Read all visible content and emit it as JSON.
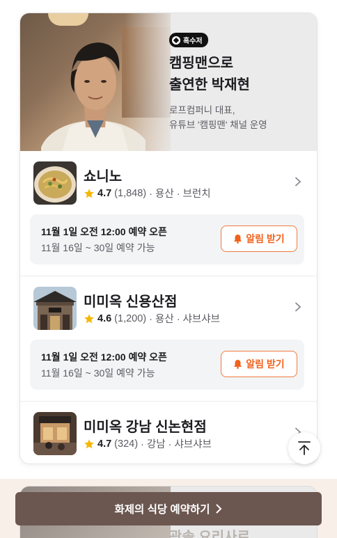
{
  "feature": {
    "badge": "흑수저",
    "title_line1": "캠핑맨으로",
    "title_line2": "출연한 박재현",
    "desc_line1": "로프컴퍼니 대표,",
    "desc_line2": "유튜브 '캠핑맨' 채널 운영"
  },
  "restaurants": [
    {
      "name": "쇼니노",
      "rating": "4.7",
      "reviews": "(1,848)",
      "meta": "· 용산 · 브런치",
      "notice_title": "11월 1일 오전 12:00 예약 오픈",
      "notice_sub": "11월 16일 ~ 30일 예약 가능",
      "alarm_label": "알림 받기"
    },
    {
      "name": "미미옥 신용산점",
      "rating": "4.6",
      "reviews": "(1,200)",
      "meta": "· 용산 · 샤브샤브",
      "notice_title": "11월 1일 오전 12:00 예약 오픈",
      "notice_sub": "11월 16일 ~ 30일 예약 가능",
      "alarm_label": "알림 받기"
    },
    {
      "name": "미미옥 강남 신논현점",
      "rating": "4.7",
      "reviews": "(324)",
      "meta": "· 강남 · 샤브샤브"
    }
  ],
  "next_feature": {
    "title": "광솔 요리사로"
  },
  "cta": {
    "label": "화제의 식당 예약하기"
  },
  "icons": {
    "star": "star-icon",
    "chevron": "chevron-right-icon",
    "bell": "bell-icon",
    "scroll_top": "arrow-up-to-top-icon"
  },
  "colors": {
    "accent": "#f0611c",
    "cta_bg": "#6b5750",
    "star": "#f5b800"
  }
}
